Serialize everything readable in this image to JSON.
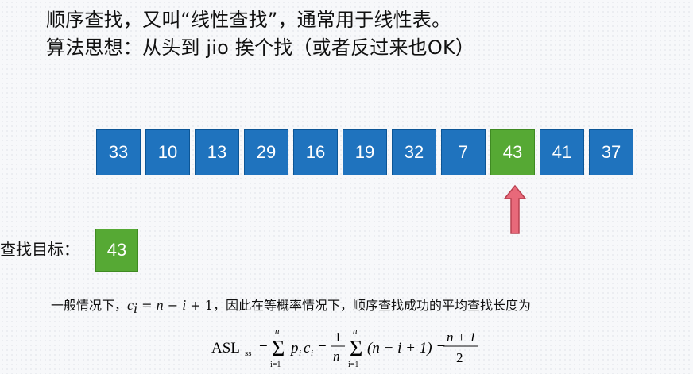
{
  "headline": {
    "line1": "顺序查找，又叫“线性查找”，通常用于线性表。",
    "line2": "算法思想：从头到 jio 挨个找（或者反过来也OK）"
  },
  "array": {
    "values": [
      "33",
      "10",
      "13",
      "29",
      "16",
      "19",
      "32",
      "7",
      "43",
      "41",
      "37"
    ],
    "highlight_index": 8,
    "colors": {
      "cell": "#1f73be",
      "found": "#56a934",
      "arrow": "#e8697a"
    }
  },
  "search_target": {
    "label": "查找目标：",
    "value": "43"
  },
  "general_case": {
    "prefix": "一般情况下，",
    "suffix": "，因此在等概率情况下，顺序查找成功的平均查找长度为"
  },
  "formula": {
    "lhs": "ASL",
    "lhs_sub": "ss",
    "sum_top": "n",
    "sum_bottom": "i=1",
    "frac1_num": "1",
    "frac1_den": "n",
    "term": "(n − i + 1) =",
    "frac2_num": "n + 1",
    "frac2_den": "2"
  }
}
